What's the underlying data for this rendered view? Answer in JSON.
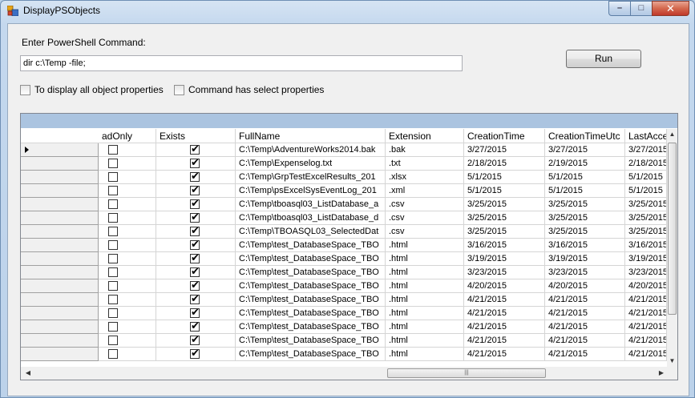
{
  "window": {
    "title": "DisplayPSObjects",
    "minimize": "–",
    "maximize": "□",
    "close": "✕"
  },
  "form": {
    "command_label": "Enter PowerShell Command:",
    "command_value": "dir c:\\Temp -file;",
    "run_label": "Run",
    "checkbox_all_props": "To display all object properties",
    "checkbox_select_props": "Command has select properties"
  },
  "grid": {
    "columns": [
      "adOnly",
      "Exists",
      "FullName",
      "Extension",
      "CreationTime",
      "CreationTimeUtc",
      "LastAcce"
    ],
    "rows": [
      {
        "readonly": false,
        "exists": true,
        "fullname": "C:\\Temp\\AdventureWorks2014.bak",
        "ext": ".bak",
        "ctime": "3/27/2015",
        "ctimeutc": "3/27/2015",
        "lastacc": "3/27/2015"
      },
      {
        "readonly": false,
        "exists": true,
        "fullname": "C:\\Temp\\Expenselog.txt",
        "ext": ".txt",
        "ctime": "2/18/2015",
        "ctimeutc": "2/19/2015",
        "lastacc": "2/18/2015"
      },
      {
        "readonly": false,
        "exists": true,
        "fullname": "C:\\Temp\\GrpTestExcelResults_201",
        "ext": ".xlsx",
        "ctime": "5/1/2015",
        "ctimeutc": "5/1/2015",
        "lastacc": "5/1/2015"
      },
      {
        "readonly": false,
        "exists": true,
        "fullname": "C:\\Temp\\psExcelSysEventLog_201",
        "ext": ".xml",
        "ctime": "5/1/2015",
        "ctimeutc": "5/1/2015",
        "lastacc": "5/1/2015"
      },
      {
        "readonly": false,
        "exists": true,
        "fullname": "C:\\Temp\\tboasql03_ListDatabase_a",
        "ext": ".csv",
        "ctime": "3/25/2015",
        "ctimeutc": "3/25/2015",
        "lastacc": "3/25/2015"
      },
      {
        "readonly": false,
        "exists": true,
        "fullname": "C:\\Temp\\tboasql03_ListDatabase_d",
        "ext": ".csv",
        "ctime": "3/25/2015",
        "ctimeutc": "3/25/2015",
        "lastacc": "3/25/2015"
      },
      {
        "readonly": false,
        "exists": true,
        "fullname": "C:\\Temp\\TBOASQL03_SelectedDat",
        "ext": ".csv",
        "ctime": "3/25/2015",
        "ctimeutc": "3/25/2015",
        "lastacc": "3/25/2015"
      },
      {
        "readonly": false,
        "exists": true,
        "fullname": "C:\\Temp\\test_DatabaseSpace_TBO",
        "ext": ".html",
        "ctime": "3/16/2015",
        "ctimeutc": "3/16/2015",
        "lastacc": "3/16/2015"
      },
      {
        "readonly": false,
        "exists": true,
        "fullname": "C:\\Temp\\test_DatabaseSpace_TBO",
        "ext": ".html",
        "ctime": "3/19/2015",
        "ctimeutc": "3/19/2015",
        "lastacc": "3/19/2015"
      },
      {
        "readonly": false,
        "exists": true,
        "fullname": "C:\\Temp\\test_DatabaseSpace_TBO",
        "ext": ".html",
        "ctime": "3/23/2015",
        "ctimeutc": "3/23/2015",
        "lastacc": "3/23/2015"
      },
      {
        "readonly": false,
        "exists": true,
        "fullname": "C:\\Temp\\test_DatabaseSpace_TBO",
        "ext": ".html",
        "ctime": "4/20/2015",
        "ctimeutc": "4/20/2015",
        "lastacc": "4/20/2015"
      },
      {
        "readonly": false,
        "exists": true,
        "fullname": "C:\\Temp\\test_DatabaseSpace_TBO",
        "ext": ".html",
        "ctime": "4/21/2015",
        "ctimeutc": "4/21/2015",
        "lastacc": "4/21/2015"
      },
      {
        "readonly": false,
        "exists": true,
        "fullname": "C:\\Temp\\test_DatabaseSpace_TBO",
        "ext": ".html",
        "ctime": "4/21/2015",
        "ctimeutc": "4/21/2015",
        "lastacc": "4/21/2015"
      },
      {
        "readonly": false,
        "exists": true,
        "fullname": "C:\\Temp\\test_DatabaseSpace_TBO",
        "ext": ".html",
        "ctime": "4/21/2015",
        "ctimeutc": "4/21/2015",
        "lastacc": "4/21/2015"
      },
      {
        "readonly": false,
        "exists": true,
        "fullname": "C:\\Temp\\test_DatabaseSpace_TBO",
        "ext": ".html",
        "ctime": "4/21/2015",
        "ctimeutc": "4/21/2015",
        "lastacc": "4/21/2015"
      },
      {
        "readonly": false,
        "exists": true,
        "fullname": "C:\\Temp\\test_DatabaseSpace_TBO",
        "ext": ".html",
        "ctime": "4/21/2015",
        "ctimeutc": "4/21/2015",
        "lastacc": "4/21/2015"
      }
    ]
  },
  "icons": {
    "app": "app-window-icon",
    "row_pointer": "current-row-arrow-icon",
    "check": "✔",
    "scroll_grip": "|||"
  }
}
